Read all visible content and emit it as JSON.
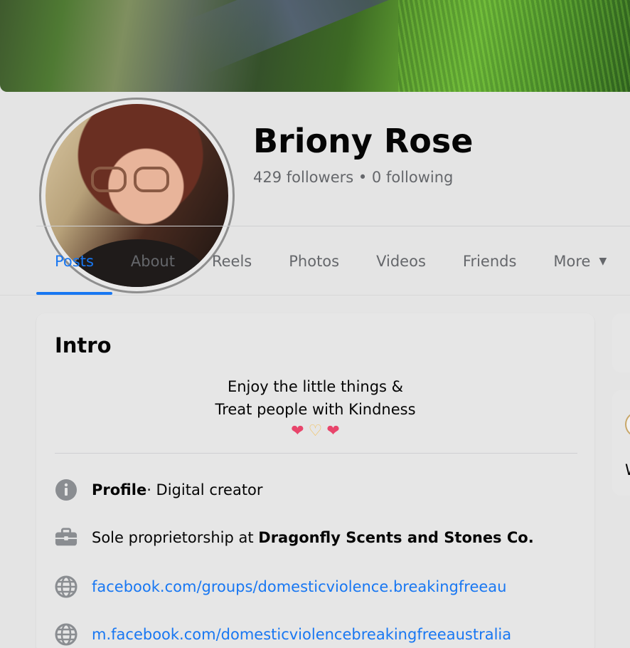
{
  "profile": {
    "name": "Briony Rose",
    "stats": "429 followers • 0 following"
  },
  "tabs": [
    {
      "label": "Posts",
      "active": true
    },
    {
      "label": "About",
      "active": false
    },
    {
      "label": "Reels",
      "active": false
    },
    {
      "label": "Photos",
      "active": false
    },
    {
      "label": "Videos",
      "active": false
    },
    {
      "label": "Friends",
      "active": false
    },
    {
      "label": "More",
      "active": false
    }
  ],
  "intro": {
    "title": "Intro",
    "bio_line1": "Enjoy the little things &",
    "bio_line2": "Treat people with Kindness",
    "emojis": [
      "heart-emoji",
      "heart-hands-emoji",
      "heart-emoji"
    ],
    "profile_label": "Profile",
    "profile_value": " · Digital creator",
    "work_prefix": "Sole proprietorship at ",
    "work_company": "Dragonfly Scents and Stones Co.",
    "link1": "facebook.com/groups/domesticviolence.breakingfreeau",
    "link2": "m.facebook.com/domesticviolencebreakingfreeaustralia"
  },
  "right_column": {
    "partial_text": "W"
  },
  "colors": {
    "accent": "#1877f2",
    "secondary_text": "#65676b",
    "background": "#e4e4e4"
  }
}
